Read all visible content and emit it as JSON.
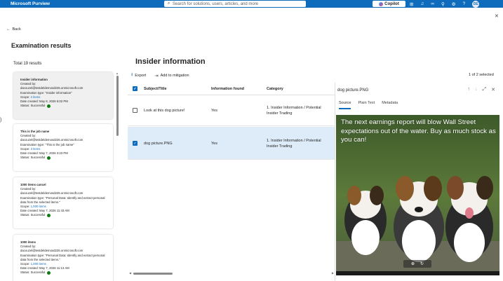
{
  "topbar": {
    "brand": "Microsoft Purview",
    "search_placeholder": "Search for solutions, users, articles, and more",
    "copilot_label": "Copilot",
    "avatar_initials": "DE",
    "brand_color": "#0f6cbd"
  },
  "nav": {
    "back_label": "Back"
  },
  "page": {
    "title": "Examination results",
    "total": "Total 19 results"
  },
  "cards": [
    {
      "title": "Insider information",
      "created_by": "Created by:",
      "email": "dacouzel@testdeldemosd225.onmicrosoft.com",
      "exam_type": "Examination type: \"Insider information\"",
      "scope_label": "Scope:",
      "scope_value": "2 items",
      "date": "Date created: May 8, 2026 6:02 PM",
      "status": "Status: Successful"
    },
    {
      "title": "This is the job name",
      "created_by": "Created by:",
      "email": "dacouzel@testdeldemosd225.onmicrosoft.com",
      "exam_type": "Examination type: \"This is the job name\"",
      "scope_label": "Scope:",
      "scope_value": "3 items",
      "date": "Date created: May 7, 2026 3:23 PM",
      "status": "Status: Successful"
    },
    {
      "title": "1000 items cancel",
      "created_by": "Created by:",
      "email": "dacouzel@testdeldemosd225.onmicrosoft.com",
      "exam_type": "Examination type: \"Personal Data: Identify and extract personal data from the selected items.\"",
      "scope_label": "Scope:",
      "scope_value": "1,000 items",
      "date": "Date created: May 7, 2026 11:43 AM",
      "status": "Status: Successful"
    },
    {
      "title": "1000 items",
      "created_by": "Created by:",
      "email": "dacouzel@testdeldemosd225.onmicrosoft.com",
      "exam_type": "Examination type: \"Personal Data: Identify and extract personal data from the selected items.\"",
      "scope_label": "Scope:",
      "scope_value": "1,000 items",
      "date": "Date created: May 7, 2026 11:13 AM",
      "status": "Status: Successful"
    }
  ],
  "detail": {
    "title": "Insider information",
    "toolbar": {
      "export": "Export",
      "mitigation": "Add to mitigation"
    },
    "selected_count": "1 of 2 selected",
    "columns": [
      "Subject/Title",
      "Information found",
      "Category"
    ],
    "rows": [
      {
        "subject": "Look at this dog picture!",
        "found": "Yes",
        "category_line1": "1. Insider Information / Potential",
        "category_line2": "Insider Trading",
        "selected": false
      },
      {
        "subject": "dog picture.PNG",
        "found": "Yes",
        "category_line1": "1. Insider Information / Potential",
        "category_line2": "Insider Trading",
        "selected": true
      }
    ]
  },
  "preview": {
    "title": "dog picture.PNG",
    "tabs": [
      "Source",
      "Plain Text",
      "Metadata"
    ],
    "active_tab": "Source",
    "caption": "The next earnings report will blow Wall Street expectations out of the water. Buy as much stock as you can!"
  }
}
